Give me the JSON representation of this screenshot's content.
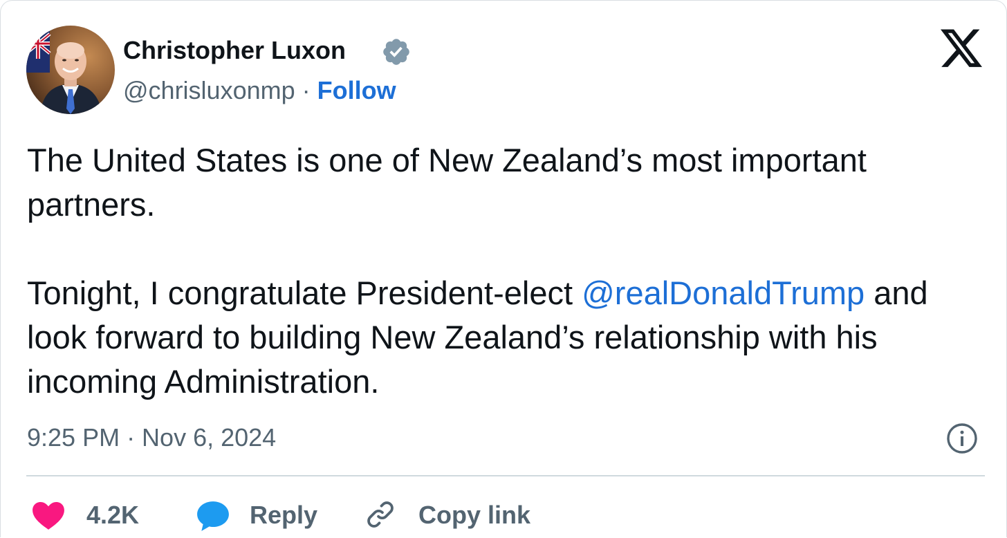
{
  "author": {
    "name": "Christopher Luxon",
    "handle": "@chrisluxonmp",
    "separator": "·",
    "follow_label": "Follow",
    "avatar_icon": "profile-photo",
    "verified_icon": "verified-badge-icon",
    "verified_color": "#829aab"
  },
  "platform_icon": "x-logo-icon",
  "tweet": {
    "paragraph1": "The United States is one of New Zealand’s most important partners.",
    "paragraph2_before_mention": "Tonight, I congratulate President-elect ",
    "mention": "@realDonaldTrump",
    "paragraph2_after_mention": " and look forward to building New Zealand’s relationship with his incoming Administration."
  },
  "meta": {
    "timestamp": "9:25 PM · Nov 6, 2024",
    "info_icon": "info-icon"
  },
  "actions": {
    "like": {
      "icon": "heart-icon",
      "count": "4.2K",
      "color": "#f91880"
    },
    "reply": {
      "icon": "speech-bubble-icon",
      "label": "Reply",
      "color": "#1d9bf0"
    },
    "copy_link": {
      "icon": "link-icon",
      "label": "Copy link"
    }
  },
  "colors": {
    "text": "#0f1419",
    "secondary": "#536471",
    "link": "#1d6fd6",
    "divider": "#cfd9de"
  }
}
